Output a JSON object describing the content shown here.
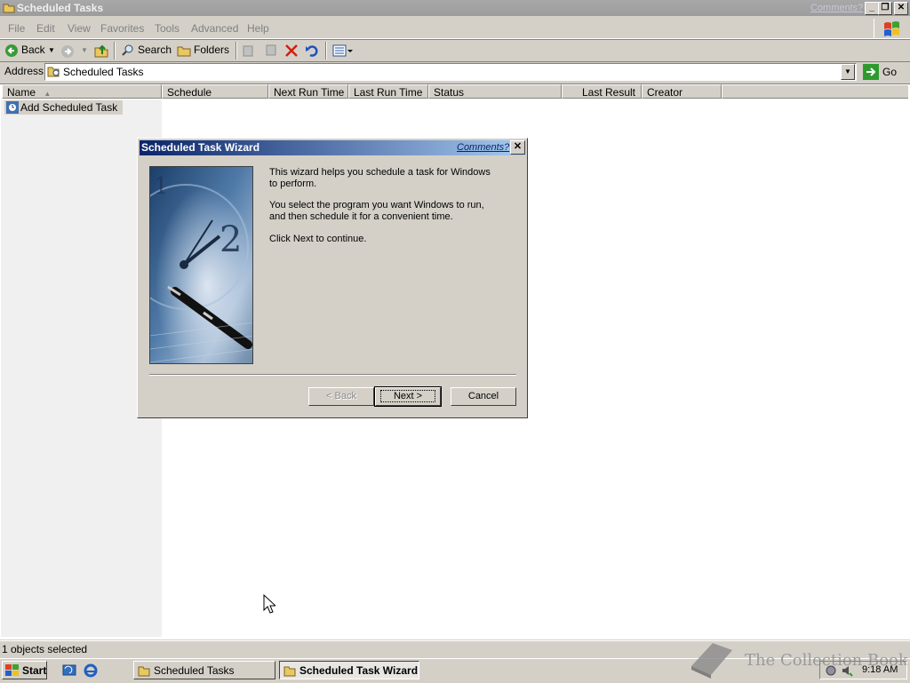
{
  "window": {
    "title": "Scheduled Tasks",
    "comments_link": "Comments?"
  },
  "menu": [
    "File",
    "Edit",
    "View",
    "Favorites",
    "Tools",
    "Advanced",
    "Help"
  ],
  "toolbar": {
    "back": "Back",
    "search": "Search",
    "folders": "Folders"
  },
  "address": {
    "label": "Address",
    "value": "Scheduled Tasks",
    "go": "Go"
  },
  "list": {
    "columns": [
      "Name",
      "Schedule",
      "Next Run Time",
      "Last Run Time",
      "Status",
      "Last Result",
      "Creator"
    ],
    "items": [
      "Add Scheduled Task"
    ]
  },
  "status": {
    "text": "1 objects selected"
  },
  "dialog": {
    "title": "Scheduled Task Wizard",
    "comments": "Comments?",
    "para1_line1": "This wizard helps you schedule a task for Windows",
    "para1_line2": "to perform.",
    "para2_line1": "You select the program you want Windows to run,",
    "para2_line2": "and then schedule it for a convenient time.",
    "para3": "Click Next to continue.",
    "back_btn": "< Back",
    "next_btn": "Next >",
    "cancel_btn": "Cancel"
  },
  "taskbar": {
    "start": "Start",
    "tasks": [
      "Scheduled Tasks",
      "Scheduled Task Wizard"
    ],
    "clock": "9:18 AM"
  },
  "watermark": "The Collection Book",
  "colors": {
    "title_active": "#0a246a",
    "title_gradient_end": "#a6caf0",
    "face": "#d4d0c8"
  }
}
